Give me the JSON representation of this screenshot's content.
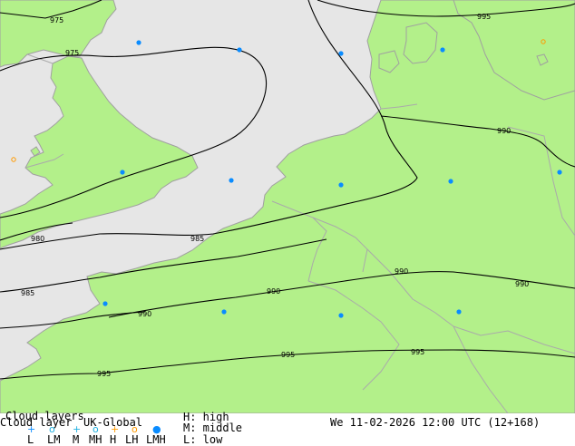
{
  "map": {
    "sea_color": "#e6e6e6",
    "land_color": "#b3f08a",
    "coast_color": "#a0a0a0",
    "border_color": "#aaaaaa",
    "isobar_color": "#000000",
    "cloud_marker_color": "#0a8cff",
    "isobars": [
      {
        "label": "975"
      },
      {
        "label": "975"
      },
      {
        "label": "980"
      },
      {
        "label": "985"
      },
      {
        "label": "985"
      },
      {
        "label": "990"
      },
      {
        "label": "990"
      },
      {
        "label": "990"
      },
      {
        "label": "990"
      },
      {
        "label": "990"
      },
      {
        "label": "995"
      },
      {
        "label": "995"
      },
      {
        "label": "995"
      },
      {
        "label": "995"
      }
    ]
  },
  "legend": {
    "title_top": "Cloud layers",
    "title_bottom": "Cloud layer",
    "model": "UK-Global",
    "level_high": "H: high",
    "level_middle": "M: middle",
    "level_low": "L: low",
    "valid_time": "We 11-02-2026 12:00 UTC (12+168)",
    "codes": [
      "L",
      "LM",
      "M",
      "MH",
      "H",
      "LH",
      "LMH"
    ],
    "symbol_colors": {
      "low": "#0a8cff",
      "middle": "#20b0e0",
      "high": "#ff9a00"
    }
  }
}
